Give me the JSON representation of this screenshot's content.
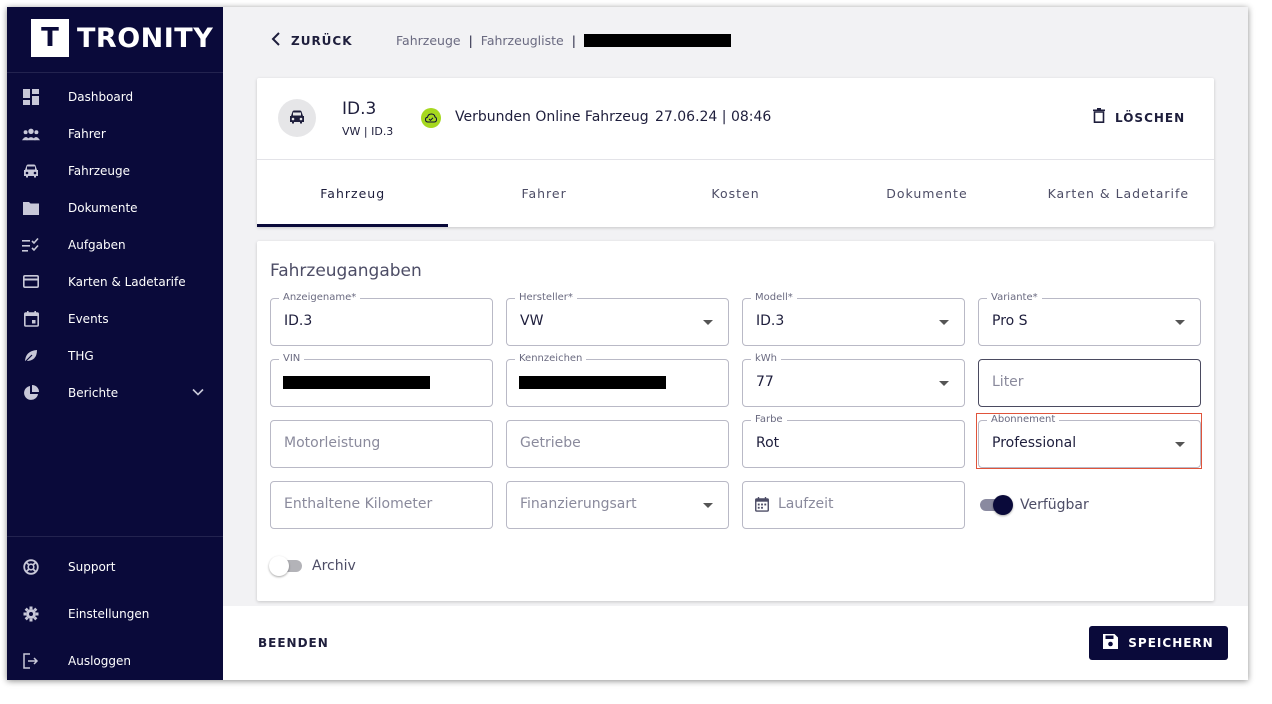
{
  "app": {
    "logo_letter": "T",
    "logo_text": "TRONITY"
  },
  "sidebar": {
    "items": [
      {
        "label": "Dashboard",
        "icon": "dashboard-icon"
      },
      {
        "label": "Fahrer",
        "icon": "people-icon"
      },
      {
        "label": "Fahrzeuge",
        "icon": "car-icon"
      },
      {
        "label": "Dokumente",
        "icon": "folder-icon"
      },
      {
        "label": "Aufgaben",
        "icon": "checklist-icon"
      },
      {
        "label": "Karten & Ladetarife",
        "icon": "card-icon"
      },
      {
        "label": "Events",
        "icon": "calendar-icon"
      },
      {
        "label": "THG",
        "icon": "leaf-icon"
      },
      {
        "label": "Berichte",
        "icon": "pie-chart-icon"
      }
    ],
    "bottom_items": [
      {
        "label": "Support",
        "icon": "support-icon"
      },
      {
        "label": "Einstellungen",
        "icon": "gear-icon"
      },
      {
        "label": "Ausloggen",
        "icon": "logout-icon"
      }
    ]
  },
  "topbar": {
    "back_label": "ZURÜCK",
    "breadcrumbs": [
      "Fahrzeuge",
      "Fahrzeugliste"
    ],
    "separator": "|"
  },
  "vehicle": {
    "name": "ID.3",
    "subtitle": "VW | ID.3",
    "status": "Verbunden Online Fahrzeug",
    "timestamp": "27.06.24 | 08:46",
    "delete_label": "LÖSCHEN"
  },
  "tabs": [
    "Fahrzeug",
    "Fahrer",
    "Kosten",
    "Dokumente",
    "Karten & Ladetarife"
  ],
  "form": {
    "title": "Fahrzeugangaben",
    "fields": {
      "anzeigename": {
        "label": "Anzeigename*",
        "value": "ID.3"
      },
      "hersteller": {
        "label": "Hersteller*",
        "value": "VW"
      },
      "modell": {
        "label": "Modell*",
        "value": "ID.3"
      },
      "variante": {
        "label": "Variante*",
        "value": "Pro S"
      },
      "vin": {
        "label": "VIN"
      },
      "kennzeichen": {
        "label": "Kennzeichen"
      },
      "kwh": {
        "label": "kWh",
        "value": "77"
      },
      "liter": {
        "placeholder": "Liter"
      },
      "motorleistung": {
        "placeholder": "Motorleistung"
      },
      "getriebe": {
        "placeholder": "Getriebe"
      },
      "farbe": {
        "label": "Farbe",
        "value": "Rot"
      },
      "abonnement": {
        "label": "Abonnement",
        "value": "Professional"
      },
      "kilometer": {
        "placeholder": "Enthaltene Kilometer"
      },
      "finanzierung": {
        "placeholder": "Finanzierungsart"
      },
      "laufzeit": {
        "placeholder": "Laufzeit"
      }
    },
    "toggles": {
      "verfuegbar": {
        "label": "Verfügbar",
        "on": true
      },
      "archiv": {
        "label": "Archiv",
        "on": false
      }
    }
  },
  "footer": {
    "finish_label": "BEENDEN",
    "save_label": "SPEICHERN"
  },
  "colors": {
    "navy": "#0a0a3a",
    "status_green": "#a6d81f",
    "highlight": "#e0543b"
  }
}
